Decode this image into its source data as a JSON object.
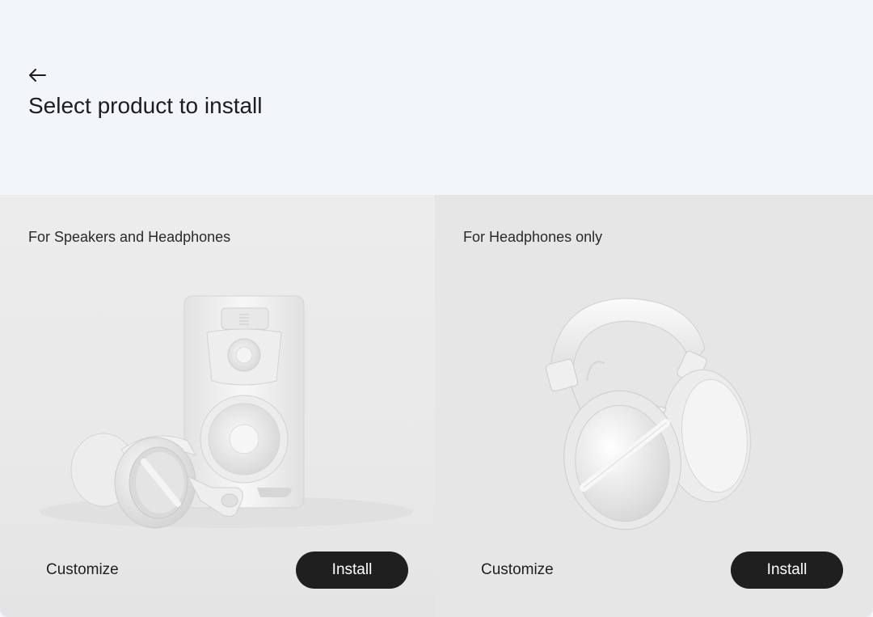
{
  "window": {
    "close_icon": "window-dot-gray"
  },
  "header": {
    "back_icon": "arrow-left-icon",
    "title": "Select product to install"
  },
  "cards": [
    {
      "title": "For Speakers and Headphones",
      "illustration": "speaker-and-headphones-image",
      "customize_label": "Customize",
      "install_label": "Install"
    },
    {
      "title": "For Headphones only",
      "illustration": "headphones-image",
      "customize_label": "Customize",
      "install_label": "Install"
    }
  ],
  "colors": {
    "header_bg": "#f2f6fa",
    "card_bg": "#e8e8e8",
    "button_bg": "#1f1f1f",
    "button_text": "#ffffff"
  }
}
